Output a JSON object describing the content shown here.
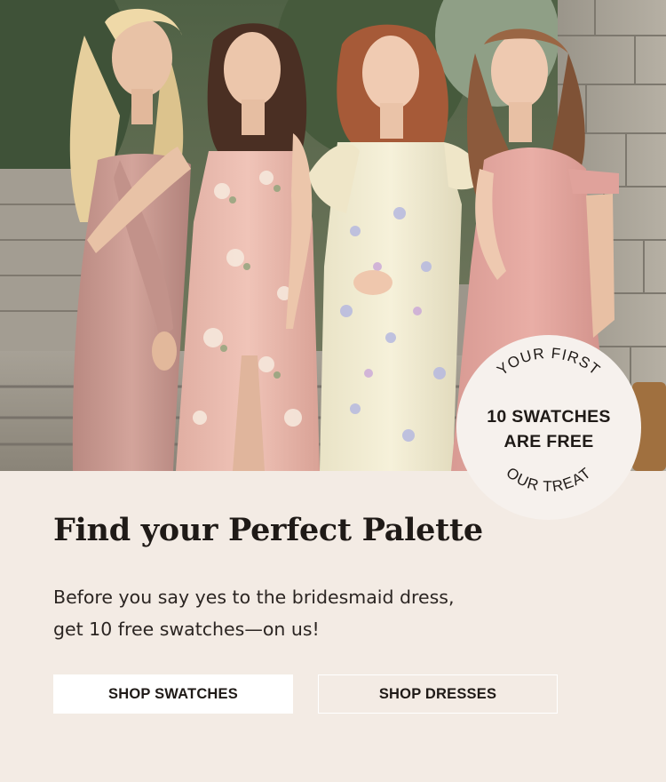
{
  "hero": {
    "image_name": "bridesmaids-photo"
  },
  "badge": {
    "top_arc": "YOUR FIRST",
    "line1": "10 SWATCHES",
    "line2": "ARE FREE",
    "bottom_arc": "OUR TREAT"
  },
  "headline": "Find your Perfect Palette",
  "body": {
    "line1": "Before you say yes to the bridesmaid dress,",
    "line2": "get 10 free swatches—on us!"
  },
  "buttons": {
    "shop_swatches": "SHOP SWATCHES",
    "shop_dresses": "SHOP DRESSES"
  },
  "colors": {
    "background": "#f3ebe4",
    "button_fill": "#ffffff",
    "text": "#1f1a17"
  }
}
